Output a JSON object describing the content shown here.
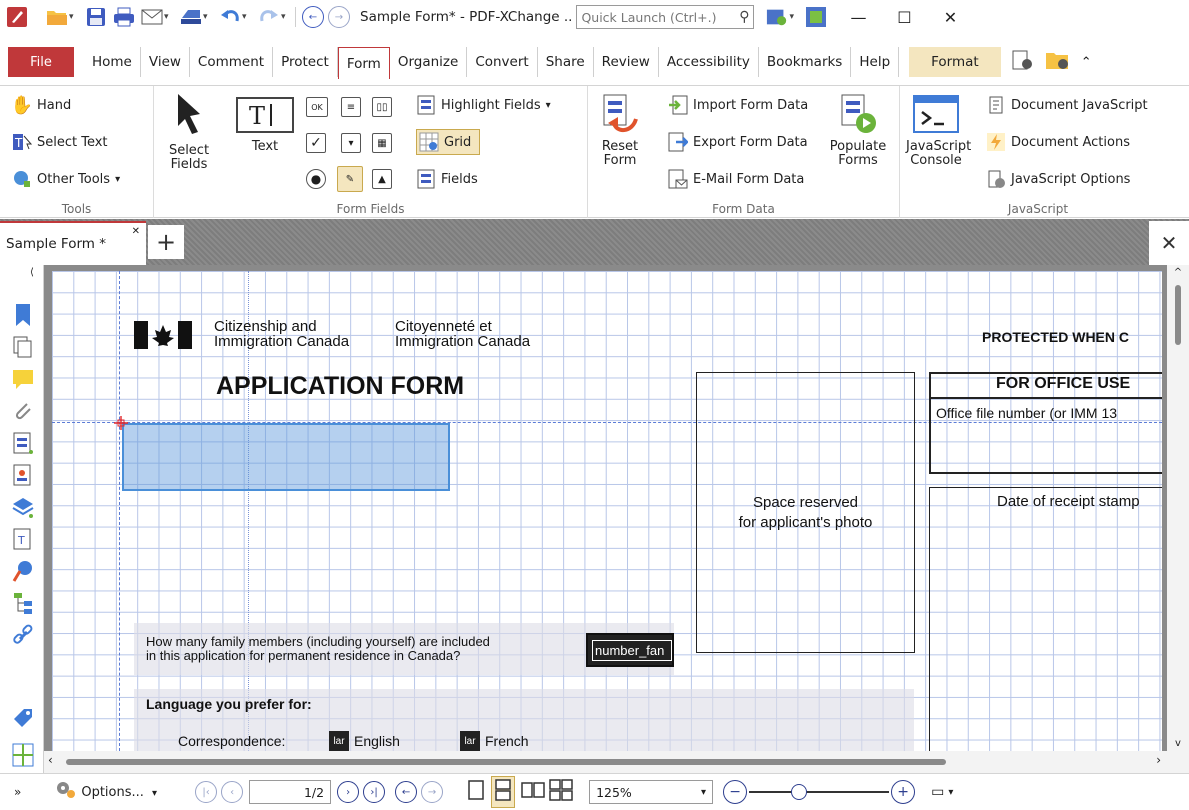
{
  "titlebar": {
    "title": "Sample Form* - PDF-XChange ..",
    "quick_launch_placeholder": "Quick Launch (Ctrl+.)"
  },
  "menu": {
    "file": "File",
    "tabs": [
      "Home",
      "View",
      "Comment",
      "Protect",
      "Form",
      "Organize",
      "Convert",
      "Share",
      "Review",
      "Accessibility",
      "Bookmarks",
      "Help"
    ],
    "active_tab": "Form",
    "format": "Format"
  },
  "ribbon": {
    "tools": {
      "label": "Tools",
      "hand": "Hand",
      "select_text": "Select Text",
      "other_tools": "Other Tools"
    },
    "form_fields": {
      "label": "Form Fields",
      "select_fields": "Select\nFields",
      "text": "Text",
      "highlight_fields": "Highlight Fields",
      "grid": "Grid",
      "fields": "Fields"
    },
    "form_data": {
      "label": "Form Data",
      "reset_form": "Reset\nForm",
      "import": "Import Form Data",
      "export": "Export Form Data",
      "email": "E-Mail Form Data",
      "populate": "Populate\nForms"
    },
    "javascript": {
      "label": "JavaScript",
      "console": "JavaScript\nConsole",
      "doc_js": "Document JavaScript",
      "doc_actions": "Document Actions",
      "js_options": "JavaScript Options"
    }
  },
  "doc_tab": {
    "title": "Sample Form *"
  },
  "page": {
    "dept_en": "Citizenship and\nImmigration Canada",
    "dept_fr": "Citoyenneté et\nImmigration Canada",
    "protected": "PROTECTED WHEN C",
    "heading": "APPLICATION FORM",
    "photo": "Space reserved\nfor applicant's photo",
    "office_use": "FOR OFFICE USE",
    "office_file": "Office file number (or IMM 13",
    "receipt": "Date of receipt stamp",
    "family_q": "How many family members (including yourself) are included\nin this application for permanent residence in Canada?",
    "family_field": "number_fan",
    "language": "Language you prefer for:",
    "correspondence": "Correspondence:",
    "lang_tag": "lar",
    "english": "English",
    "french": "French"
  },
  "status": {
    "options": "Options...",
    "page_display": "1/2",
    "zoom": "125%"
  }
}
